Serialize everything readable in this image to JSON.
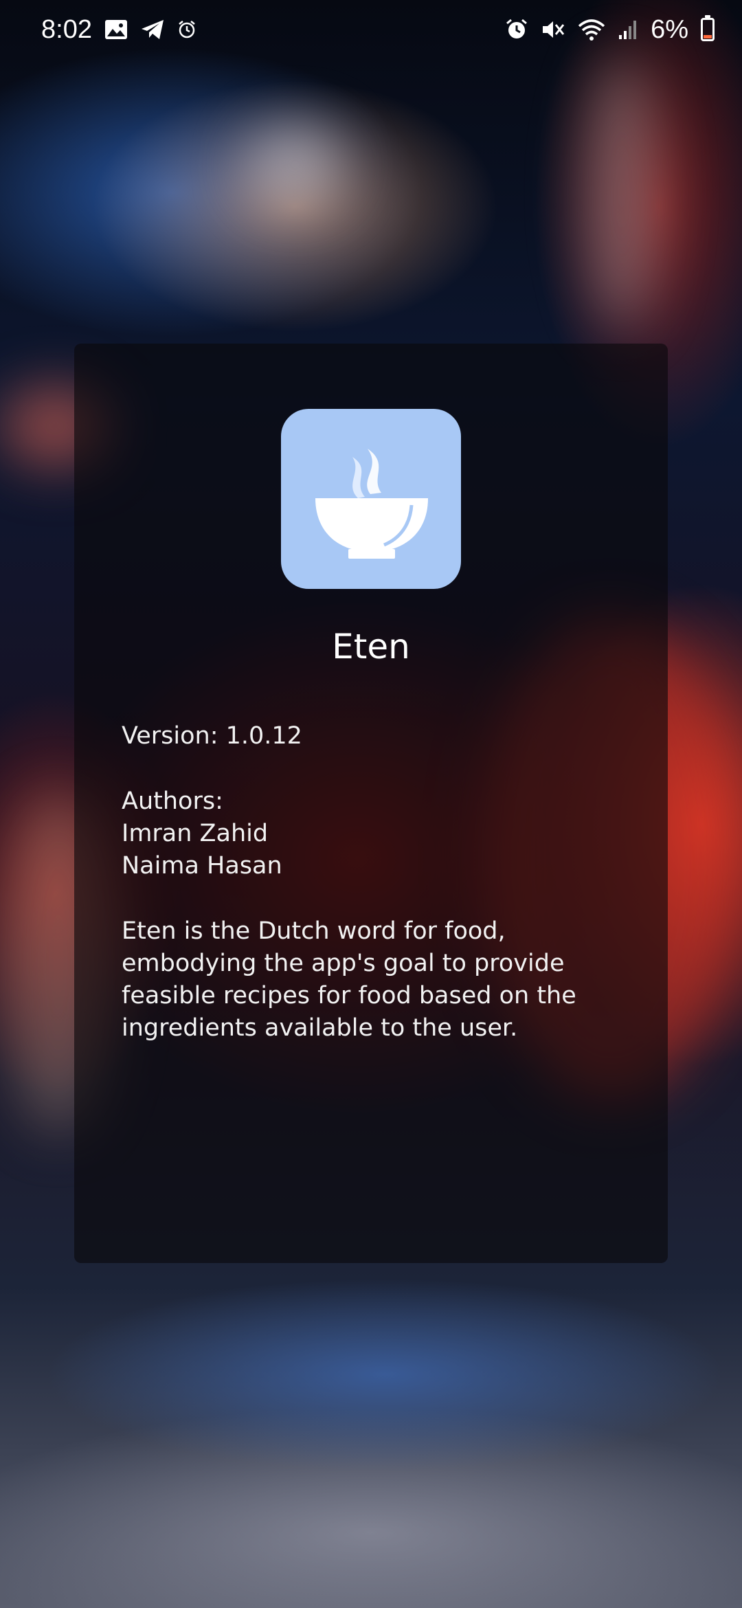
{
  "status_bar": {
    "time": "8:02",
    "battery": "6%",
    "left_icons": [
      "gallery-icon",
      "telegram-icon",
      "alarm-clock-icon"
    ],
    "right_icons": [
      "alarm-icon",
      "mute-icon",
      "wifi-icon",
      "signal-icon",
      "battery-icon"
    ],
    "battery_color": "#ff6a3d"
  },
  "about": {
    "icon": "steaming-bowl-icon",
    "icon_bg": "#a8c8f5",
    "app_name": "Eten",
    "version": "Version: 1.0.12",
    "authors_label": "Authors:",
    "authors": [
      "Imran Zahid",
      "Naima Hasan"
    ],
    "description_lines": [
      "Eten is the Dutch word for food,",
      "embodying the app's goal to provide",
      "feasible recipes for food based on the",
      "ingredients available to the user."
    ]
  }
}
